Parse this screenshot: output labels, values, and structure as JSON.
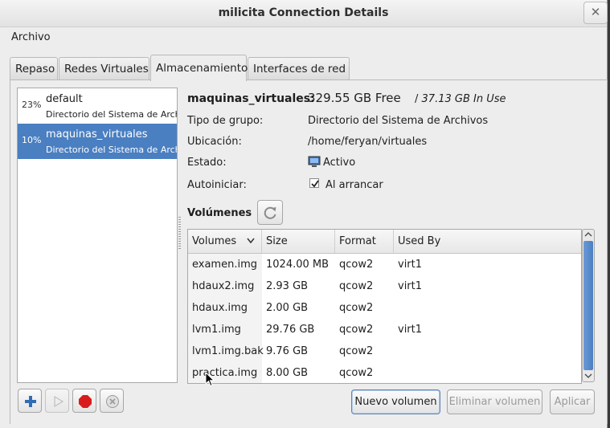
{
  "window": {
    "title": "milicita Connection Details"
  },
  "menubar": {
    "archivo": "Archivo"
  },
  "tabs": [
    {
      "label": "Repaso"
    },
    {
      "label": "Redes Virtuales"
    },
    {
      "label": "Almacenamiento",
      "active": true
    },
    {
      "label": "Interfaces de red"
    }
  ],
  "pools": [
    {
      "pct": "23%",
      "name": "default",
      "desc": "Directorio del Sistema de Archivos",
      "selected": false
    },
    {
      "pct": "10%",
      "name": "maquinas_virtuales",
      "desc": "Directorio del Sistema de Archivos",
      "selected": true
    }
  ],
  "details": {
    "pool_name": "maquinas_virtuales:",
    "free": "329.55 GB Free",
    "separator": "/",
    "in_use": "37.13 GB In Use",
    "tipo_label": "Tipo de grupo:",
    "tipo_value": "Directorio del Sistema de Archivos",
    "ubicacion_label": "Ubicación:",
    "ubicacion_value": "/home/feryan/virtuales",
    "estado_label": "Estado:",
    "estado_value": "Activo",
    "autoiniciar_label": "Autoiniciar:",
    "autoiniciar_value": "Al arrancar",
    "autoiniciar_checked": true,
    "volumenes_label": "Volúmenes"
  },
  "volumes": {
    "headers": [
      "Volumes",
      "Size",
      "Format",
      "Used By"
    ],
    "rows": [
      {
        "name": "examen.img",
        "size": "1024.00 MB",
        "format": "qcow2",
        "used_by": "virt1"
      },
      {
        "name": "hdaux2.img",
        "size": "2.93 GB",
        "format": "qcow2",
        "used_by": "virt1"
      },
      {
        "name": "hdaux.img",
        "size": "2.00 GB",
        "format": "qcow2",
        "used_by": ""
      },
      {
        "name": "lvm1.img",
        "size": "29.76 GB",
        "format": "qcow2",
        "used_by": "virt1"
      },
      {
        "name": "lvm1.img.bak",
        "size": "9.76 GB",
        "format": "qcow2",
        "used_by": ""
      },
      {
        "name": "practica.img",
        "size": "8.00 GB",
        "format": "qcow2",
        "used_by": ""
      }
    ]
  },
  "buttons": {
    "nuevo": "Nuevo volumen",
    "eliminar": "Eliminar volumen",
    "aplicar": "Aplicar"
  },
  "icons": {
    "close": "close-icon",
    "add": "add-icon",
    "play": "play-icon",
    "stop": "stop-icon",
    "delete": "delete-icon",
    "refresh": "refresh-icon",
    "status": "monitor-icon"
  },
  "colors": {
    "selection": "#4a7fc1",
    "stop_red": "#d81c1c",
    "add_blue": "#2f6db5"
  }
}
